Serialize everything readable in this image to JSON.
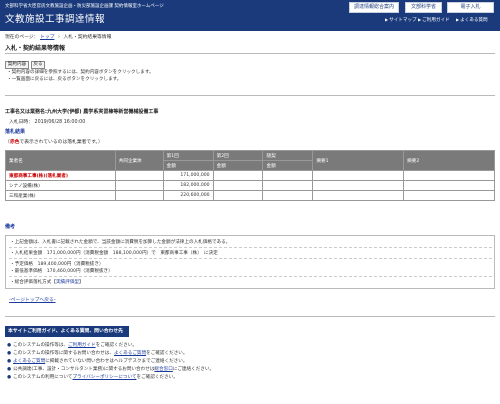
{
  "header": {
    "subtitle": "文部科学省大臣官房文教施設企画・防災部施設企画課 契約情報室ホームページ",
    "title": "文教施設工事調達情報",
    "buttons": [
      "調達情報総合案内",
      "文部科学省",
      "電子入札"
    ],
    "nav": [
      "サイトマップ",
      "ご利用ガイド",
      "よくある質問"
    ]
  },
  "breadcrumb": {
    "label": "現在のページ：",
    "home": "トップ",
    "current": "入札・契約結果等情報"
  },
  "page_title": "入札・契約結果等情報",
  "buttons": {
    "contract": "契約内容",
    "back": "戻る"
  },
  "notes": [
    "契約内容の詳細を参照するには、契約内容ボタンをクリックします。",
    "一覧画面に戻るには、戻るボタンをクリックします。"
  ],
  "subject": "工事名又は業務名:九州大学(伊都) 農学系実習棟等新営機械設備工事",
  "bid_date": {
    "label": "入札日時",
    "value": "2019/06/28 16:00:00"
  },
  "result_heading": "落札結果",
  "legend": {
    "open": "（",
    "red": "赤色",
    "rest": "で表示されているのは落札業者です。）"
  },
  "table": {
    "headers": [
      "業者名",
      "共同企業体",
      "第1回",
      "第2回",
      "随契",
      "摘要1",
      "摘要2"
    ],
    "subheader": "金額",
    "rows": [
      {
        "name": "東都商事工事(株)(落札業者)",
        "amount": "171,000,000",
        "winner": true
      },
      {
        "name": "シナノ設備(株)",
        "amount": "182,000,000",
        "winner": false
      },
      {
        "name": "三和産業(株)",
        "amount": "220,600,000",
        "winner": false
      }
    ]
  },
  "remarks_heading": "備考",
  "remarks": {
    "note": "・上記金額は、入札書に記載された金額で、当該金額に消費税を加算した金額が法律上の入札価格である。",
    "award": "・入札結果金額　171,000,000円（消費税金額　188,100,000円）で　東都商事工事（株）　に決定",
    "planned": "・予定価格　189,400,000円（消費税抜き）",
    "min_price": "・最低基準価格　170,460,000円（消費税抜き）",
    "method_prefix": "・総合評価落札方式【",
    "method": "実績評価型",
    "method_suffix": "】"
  },
  "pagetop": "ページトップへ戻る",
  "footer": {
    "heading": "本サイトご利用ガイド、よくある質問、問い合わせ先",
    "items": [
      {
        "pre": "このシステムの操作等は、",
        "link": "ご利用ガイド",
        "post": "をご確認ください。"
      },
      {
        "pre": "このシステムの操作等に関するお問い合わせは、",
        "link": "よくあるご質問",
        "post": "をご確認ください。"
      },
      {
        "pre": "",
        "link": "よくあるご質問",
        "post": "に掲載されていない問い合わせはヘルプデスクまでご連絡ください。"
      },
      {
        "pre": "公共調達(工事、設計・コンサルタント業務)に関するお問い合わせは",
        "link": "総合窓口",
        "post": "にご連絡ください。"
      },
      {
        "pre": "このシステムの利用について",
        "link": "プライバシーポリシーについて",
        "post": "をご確認ください。"
      }
    ]
  }
}
